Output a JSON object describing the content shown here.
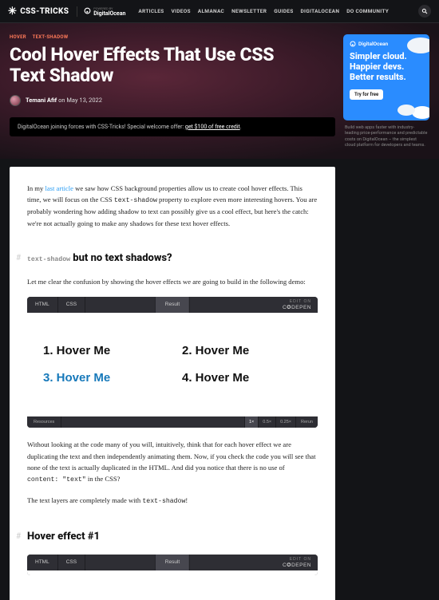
{
  "topbar": {
    "logo": "CSS-TRICKS",
    "powered_prefix": "POWERED BY",
    "powered_brand": "DigitalOcean",
    "nav": [
      "ARTICLES",
      "VIDEOS",
      "ALMANAC",
      "NEWSLETTER",
      "GUIDES",
      "DIGITALOCEAN",
      "DO COMMUNITY"
    ]
  },
  "breadcrumb": [
    "HOVER",
    "TEXT-SHADOW"
  ],
  "title": "Cool Hover Effects That Use CSS Text Shadow",
  "byline": {
    "author": "Temani Afif",
    "on": " on ",
    "date": "May 13, 2022"
  },
  "promo": {
    "text": "DigitalOcean joining forces with CSS-Tricks! Special welcome offer: ",
    "link": "get $100 of free credit"
  },
  "ad": {
    "brand": "DigitalOcean",
    "headline": "Simpler cloud. Happier devs. Better results.",
    "cta": "Try for free",
    "caption": "Build web apps faster with industry-leading price-performance and predictable costs on DigitalOcean – the simplest cloud platform for developers and teams."
  },
  "article": {
    "intro_a": "In my ",
    "intro_link": "last article",
    "intro_b": " we saw how CSS background properties allow us to create cool hover effects. This time, we will focus on the CSS ",
    "intro_code": "text-shadow",
    "intro_c": " property to explore even more interesting hovers. You are probably wondering how adding shadow to text can possibly give us a cool effect, but here's the catch: we're not actually going to make any shadows for these text hover effects.",
    "h2a_code": "text-shadow",
    "h2a_rest": " but no text shadows?",
    "p2": "Let me clear the confusion by showing the hover effects we are going to build in the following demo:",
    "p3a": "Without looking at the code many of you will, intuitively, think that for each hover effect we are duplicating the text and then independently animating them. Now, if you check the code you will see that none of the text is actually duplicated in the HTML. And did you notice that there is no use of ",
    "p3_code": "content: \"text\"",
    "p3b": " in the CSS?",
    "p4a": "The text layers are completely made with ",
    "p4_code": "text-shadow",
    "p4b": "!",
    "h2b": "Hover effect #1"
  },
  "codepen": {
    "tabs": {
      "html": "HTML",
      "css": "CSS",
      "result": "Result"
    },
    "edit_top": "EDIT ON",
    "edit_brand": "C✪DEPEN",
    "items": [
      "1. Hover Me",
      "2. Hover Me",
      "3. Hover Me",
      "4. Hover Me"
    ],
    "footer": {
      "resources": "Resources",
      "zoom": [
        "1×",
        "0.5×",
        "0.25×"
      ],
      "rerun": "Rerun"
    }
  }
}
